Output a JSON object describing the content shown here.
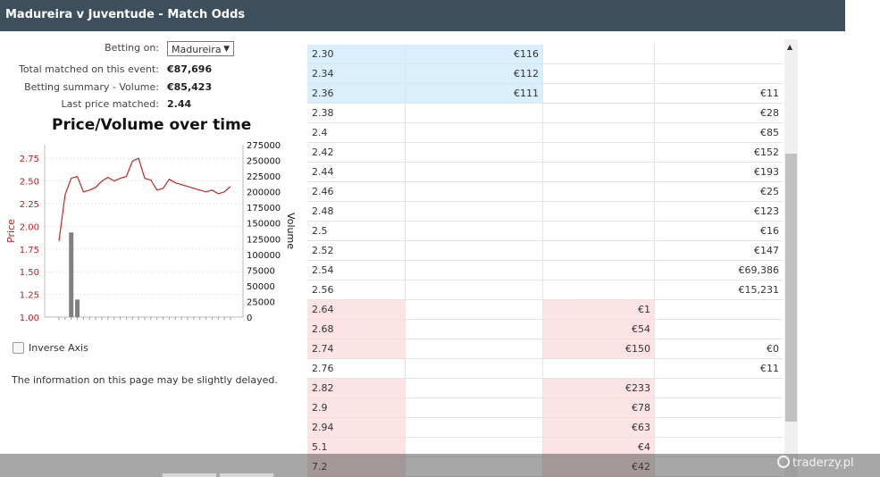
{
  "header": {
    "title": "Madureira v Juventude - Match Odds"
  },
  "betting_on": {
    "label": "Betting on:",
    "selected": "Madureira"
  },
  "stats": [
    {
      "label": "Total matched on this event:",
      "value": "€87,696"
    },
    {
      "label": "Betting summary - Volume:",
      "value": "€85,423"
    },
    {
      "label": "Last price matched:",
      "value": "2.44"
    }
  ],
  "chart_data": {
    "type": "line",
    "title": "Price/Volume over time",
    "ylabel": "Price",
    "y2label": "Volume",
    "ylim": [
      1.0,
      2.9
    ],
    "y2lim": [
      0,
      275000
    ],
    "yticks": [
      "2.75",
      "2.50",
      "2.25",
      "2.00",
      "1.75",
      "1.50",
      "1.25",
      "1.00"
    ],
    "y2ticks": [
      "275000",
      "250000",
      "225000",
      "200000",
      "175000",
      "150000",
      "125000",
      "100000",
      "75000",
      "50000",
      "25000",
      "0"
    ],
    "price_series": [
      1.84,
      2.35,
      2.53,
      2.55,
      2.38,
      2.4,
      2.43,
      2.5,
      2.54,
      2.5,
      2.53,
      2.55,
      2.72,
      2.75,
      2.53,
      2.51,
      2.4,
      2.42,
      2.52,
      2.48,
      2.46,
      2.44,
      2.42,
      2.4,
      2.38,
      2.4,
      2.36,
      2.38,
      2.44
    ],
    "volume_bars": [
      0,
      0,
      135000,
      28000,
      0,
      0,
      0,
      0,
      0,
      0,
      0,
      0,
      0,
      0,
      0,
      0,
      0,
      0,
      0,
      0,
      0,
      0,
      0,
      0,
      0,
      0,
      0,
      0,
      0
    ],
    "grid": true
  },
  "inverse_axis": {
    "label": "Inverse Axis",
    "checked": false
  },
  "note": "The information on this page may be slightly delayed.",
  "ladder": [
    {
      "price": "2.30",
      "back": "€116",
      "lay": "",
      "traded": "",
      "zone": "back"
    },
    {
      "price": "2.34",
      "back": "€112",
      "lay": "",
      "traded": "",
      "zone": "back"
    },
    {
      "price": "2.36",
      "back": "€111",
      "lay": "",
      "traded": "€11",
      "zone": "back"
    },
    {
      "price": "2.38",
      "back": "",
      "lay": "",
      "traded": "€28",
      "zone": "none"
    },
    {
      "price": "2.4",
      "back": "",
      "lay": "",
      "traded": "€85",
      "zone": "none"
    },
    {
      "price": "2.42",
      "back": "",
      "lay": "",
      "traded": "€152",
      "zone": "none"
    },
    {
      "price": "2.44",
      "back": "",
      "lay": "",
      "traded": "€193",
      "zone": "none"
    },
    {
      "price": "2.46",
      "back": "",
      "lay": "",
      "traded": "€25",
      "zone": "none"
    },
    {
      "price": "2.48",
      "back": "",
      "lay": "",
      "traded": "€123",
      "zone": "none"
    },
    {
      "price": "2.5",
      "back": "",
      "lay": "",
      "traded": "€16",
      "zone": "none"
    },
    {
      "price": "2.52",
      "back": "",
      "lay": "",
      "traded": "€147",
      "zone": "none"
    },
    {
      "price": "2.54",
      "back": "",
      "lay": "",
      "traded": "€69,386",
      "zone": "none"
    },
    {
      "price": "2.56",
      "back": "",
      "lay": "",
      "traded": "€15,231",
      "zone": "none"
    },
    {
      "price": "2.64",
      "back": "",
      "lay": "€1",
      "traded": "",
      "zone": "lay"
    },
    {
      "price": "2.68",
      "back": "",
      "lay": "€54",
      "traded": "",
      "zone": "lay"
    },
    {
      "price": "2.74",
      "back": "",
      "lay": "€150",
      "traded": "€0",
      "zone": "lay"
    },
    {
      "price": "2.76",
      "back": "",
      "lay": "",
      "traded": "€11",
      "zone": "none"
    },
    {
      "price": "2.82",
      "back": "",
      "lay": "€233",
      "traded": "",
      "zone": "lay"
    },
    {
      "price": "2.9",
      "back": "",
      "lay": "€78",
      "traded": "",
      "zone": "lay"
    },
    {
      "price": "2.94",
      "back": "",
      "lay": "€63",
      "traded": "",
      "zone": "lay"
    },
    {
      "price": "5.1",
      "back": "",
      "lay": "€4",
      "traded": "",
      "zone": "lay"
    },
    {
      "price": "7.2",
      "back": "",
      "lay": "€42",
      "traded": "",
      "zone": "lay"
    }
  ],
  "watermark": "traderzy.pl",
  "colors": {
    "header": "#3d4f5c",
    "back": "#dbeefb",
    "lay": "#fce3e6",
    "price_line": "#cc2222",
    "volume_bar": "#808080"
  }
}
